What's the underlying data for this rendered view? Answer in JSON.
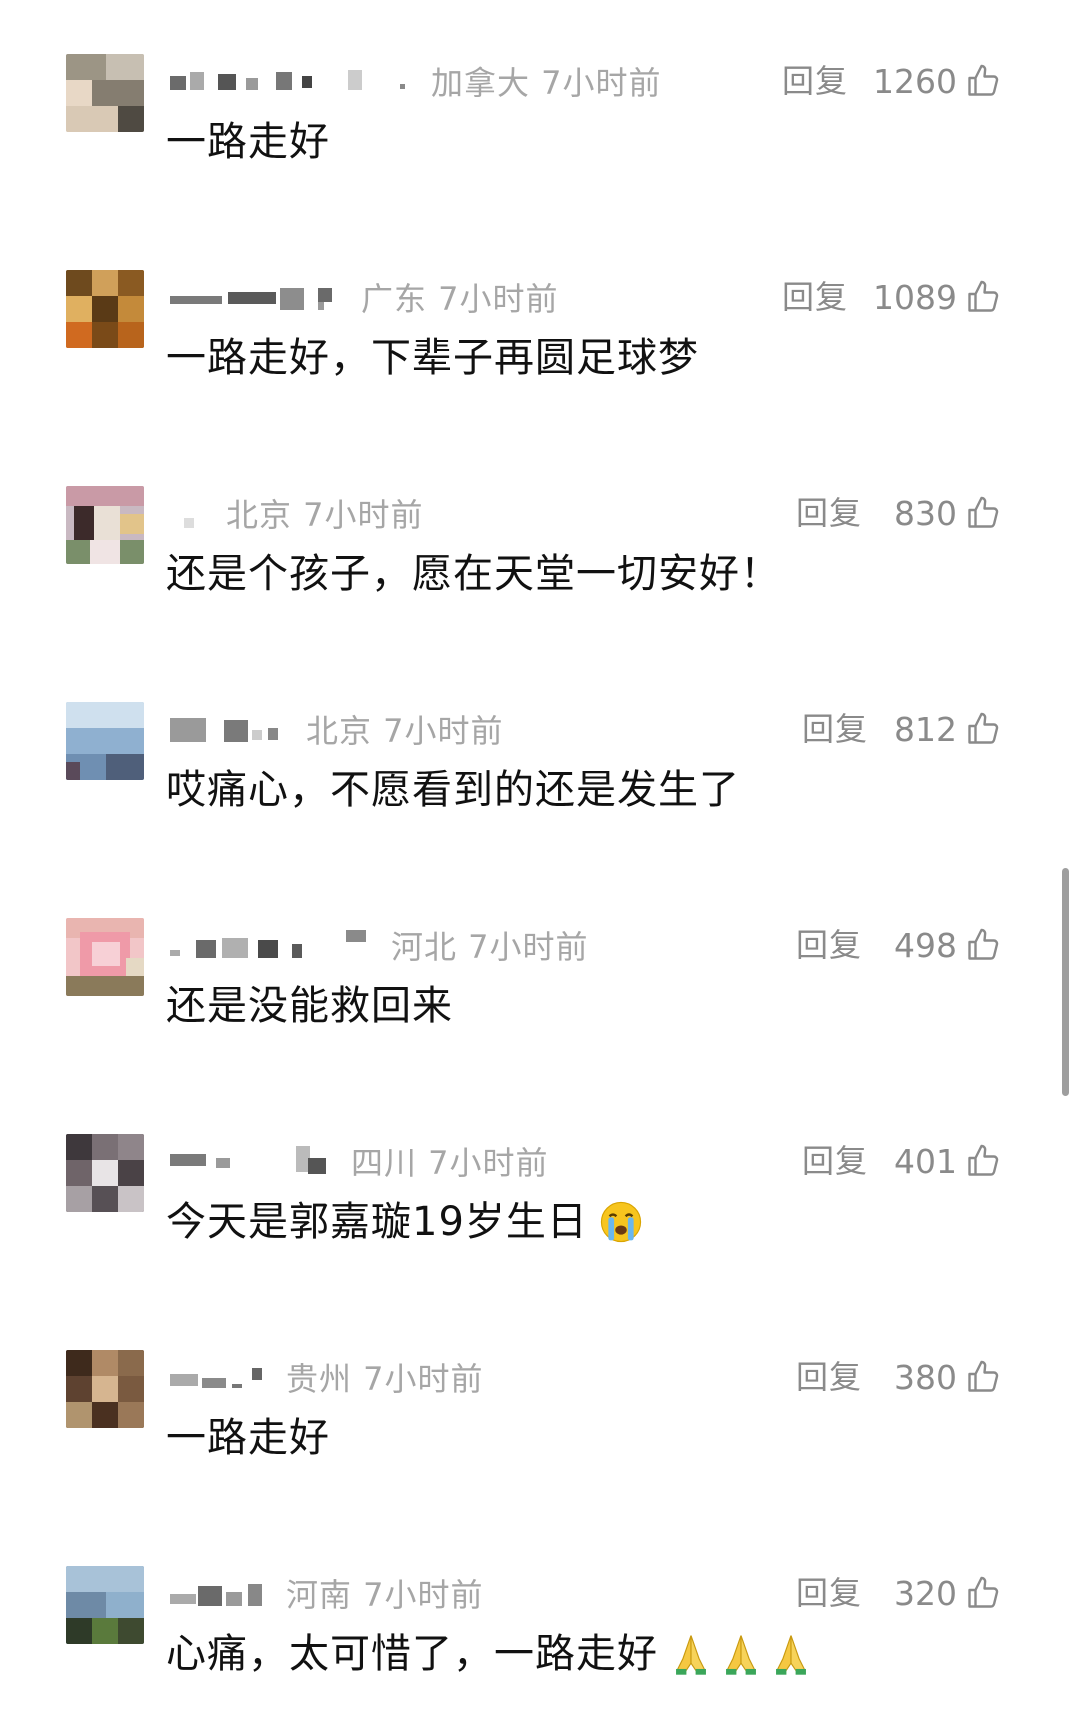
{
  "comments": [
    {
      "region_time": "加拿大 7小时前",
      "reply_label": "回复",
      "likes": "1260",
      "text": "一路走好",
      "emojis": []
    },
    {
      "region_time": "广东 7小时前",
      "reply_label": "回复",
      "likes": "1089",
      "text": "一路走好，下辈子再圆足球梦",
      "emojis": []
    },
    {
      "region_time": "北京 7小时前",
      "reply_label": "回复",
      "likes": "830",
      "text": "还是个孩子，愿在天堂一切安好！",
      "emojis": []
    },
    {
      "region_time": "北京 7小时前",
      "reply_label": "回复",
      "likes": "812",
      "text": "哎痛心，不愿看到的还是发生了",
      "emojis": []
    },
    {
      "region_time": "河北 7小时前",
      "reply_label": "回复",
      "likes": "498",
      "text": "还是没能救回来",
      "emojis": []
    },
    {
      "region_time": "四川 7小时前",
      "reply_label": "回复",
      "likes": "401",
      "text": "今天是郭嘉璇19岁生日",
      "emojis": [
        "crying-face-emoji"
      ]
    },
    {
      "region_time": "贵州 7小时前",
      "reply_label": "回复",
      "likes": "380",
      "text": "一路走好",
      "emojis": []
    },
    {
      "region_time": "河南 7小时前",
      "reply_label": "回复",
      "likes": "320",
      "text": "心痛，太可惜了，一路走好",
      "emojis": [
        "folded-hands-emoji",
        "folded-hands-emoji",
        "folded-hands-emoji"
      ]
    }
  ],
  "icons": {
    "like": "thumbs-up-outline-icon"
  },
  "colors": {
    "meta_text": "#a6a6a6",
    "secondary_text": "#8a8a8a",
    "body_text": "#111111",
    "background": "#ffffff"
  }
}
